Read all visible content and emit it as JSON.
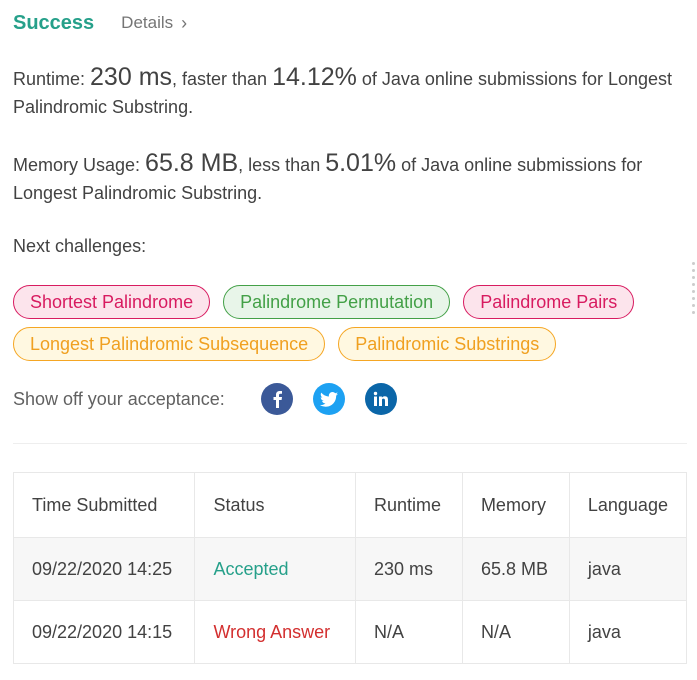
{
  "header": {
    "success_label": "Success",
    "details_label": "Details",
    "details_icon": "chevron-right-icon"
  },
  "runtime": {
    "prefix": "Runtime: ",
    "value": "230 ms",
    "middle": ", faster than ",
    "percent": "14.12%",
    "suffix": " of Java online submissions for Longest Palindromic Substring."
  },
  "memory": {
    "prefix": "Memory Usage: ",
    "value": "65.8 MB",
    "middle": ", less than ",
    "percent": "5.01%",
    "suffix": " of Java online submissions for Longest Palindromic Substring."
  },
  "next_challenges": {
    "label": "Next challenges:",
    "items": [
      {
        "label": "Shortest Palindrome",
        "difficulty": "hard"
      },
      {
        "label": "Palindrome Permutation",
        "difficulty": "easy"
      },
      {
        "label": "Palindrome Pairs",
        "difficulty": "hard"
      },
      {
        "label": "Longest Palindromic Subsequence",
        "difficulty": "medium"
      },
      {
        "label": "Palindromic Substrings",
        "difficulty": "medium"
      }
    ]
  },
  "share": {
    "label": "Show off your acceptance:",
    "icons": [
      "facebook-icon",
      "twitter-icon",
      "linkedin-icon"
    ]
  },
  "submissions": {
    "columns": [
      "Time Submitted",
      "Status",
      "Runtime",
      "Memory",
      "Language"
    ],
    "rows": [
      {
        "time": "09/22/2020 14:25",
        "status": "Accepted",
        "runtime": "230 ms",
        "memory": "65.8 MB",
        "language": "java"
      },
      {
        "time": "09/22/2020 14:15",
        "status": "Wrong Answer",
        "runtime": "N/A",
        "memory": "N/A",
        "language": "java"
      }
    ]
  },
  "colors": {
    "accent": "#26a08a",
    "hard": "#d81b60",
    "easy": "#43a047",
    "medium": "#f0a020",
    "wrong": "#d32f2f"
  }
}
